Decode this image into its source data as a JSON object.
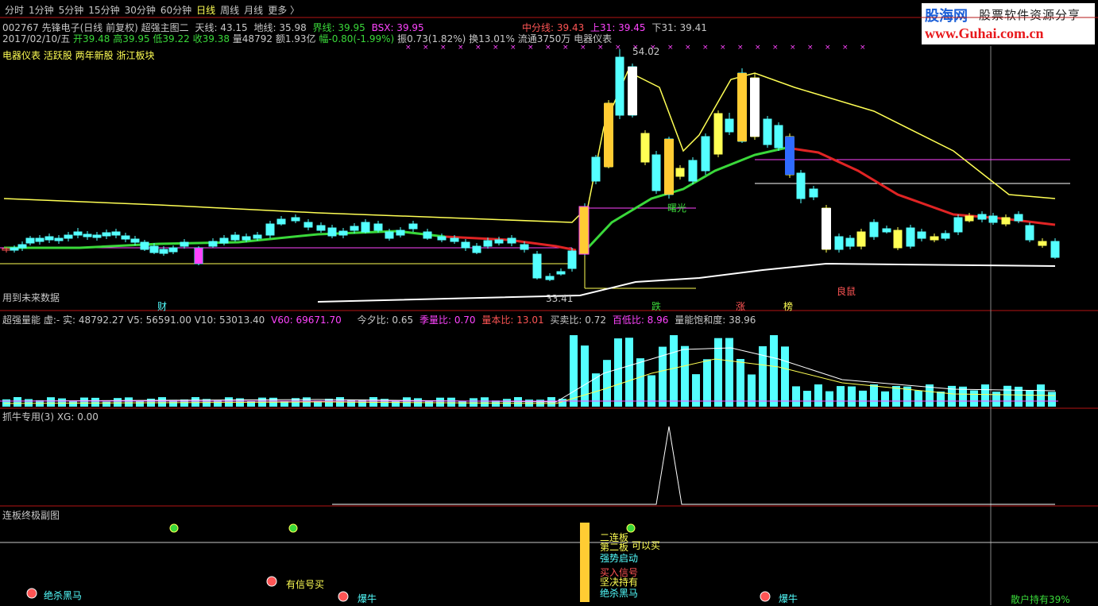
{
  "tabs": [
    {
      "label": "分时",
      "active": false
    },
    {
      "label": "1分钟",
      "active": false
    },
    {
      "label": "5分钟",
      "active": false
    },
    {
      "label": "15分钟",
      "active": false
    },
    {
      "label": "30分钟",
      "active": false
    },
    {
      "label": "60分钟",
      "active": false
    },
    {
      "label": "日线",
      "active": true
    },
    {
      "label": "周线",
      "active": false
    },
    {
      "label": "月线",
      "active": false
    },
    {
      "label": "更多 〉",
      "active": false
    }
  ],
  "brand": {
    "cn": "股海网",
    "slogan": "股票软件资源分享",
    "url": "www.Guhai.com.cn"
  },
  "main": {
    "line1": {
      "code": "002767 先锋电子(日线 前复权) 超强主图二",
      "tian": "天线: 43.15",
      "di": "地线: 35.98",
      "jie": "界线: 39.95",
      "bsx": "BSX: 39.95",
      "zhong": "中分线: 39.43",
      "shang": "上31: 39.45",
      "xia": "下31: 39.41"
    },
    "line2": {
      "date": "2017/02/10/五",
      "open": "开39.48",
      "high": "高39.95",
      "low": "低39.22",
      "close": "收39.38",
      "vol": "量48792",
      "amt": "额1.93亿",
      "chg": "幅-0.80(-1.99%)",
      "amp": "振0.73(1.82%)",
      "turn": "换13.01%",
      "float": "流通3750万",
      "industry": "电器仪表"
    },
    "line3": "电器仪表 活跃股 两年新股 浙江板块",
    "max_label": "54.02",
    "min_label": "33.41",
    "notes": {
      "future": "用到未来数据",
      "shuguang": "曙光",
      "liangshu": "良鼠",
      "cai": "财",
      "die": "跌",
      "zhang": "涨",
      "bang": "榜"
    }
  },
  "volume_panel": {
    "title": "超强量能 虚:-  实: 48792.27  V5: 56591.00  V10: 53013.40",
    "v60": "V60: 69671.70",
    "jinxi": "今夕比: 0.65",
    "jiliang": "季量比: 0.70",
    "liangben": "量本比: 13.01",
    "maimai": "买卖比: 0.72",
    "baidi": "百低比: 8.96",
    "baohe": "量能饱和度: 38.96"
  },
  "zhuaniu_panel": {
    "title": "抓牛专用(3)  XG: 0.00"
  },
  "lianban_panel": {
    "title": "连板终极副图",
    "labels": {
      "jueshao": "绝杀黑马",
      "youxinhao": "有信号买",
      "baoniu1": "爆牛",
      "baoniu2": "爆牛",
      "erlianban": "二连板",
      "dierban": "第二板",
      "kemai": "可以买",
      "qiangshi": "强势启动",
      "jianchi": "坚决持有",
      "maidian": "买入信号",
      "jueshao2": "绝杀黑马",
      "sanhu": "散户持有39%"
    }
  },
  "colors": {
    "up": "#ff5555",
    "down": "#54ffff",
    "yellow": "#ffff54",
    "green": "#3ad83a",
    "magenta": "#ff44ff",
    "white": "#ffffff",
    "red_ma": "#e02424"
  }
}
